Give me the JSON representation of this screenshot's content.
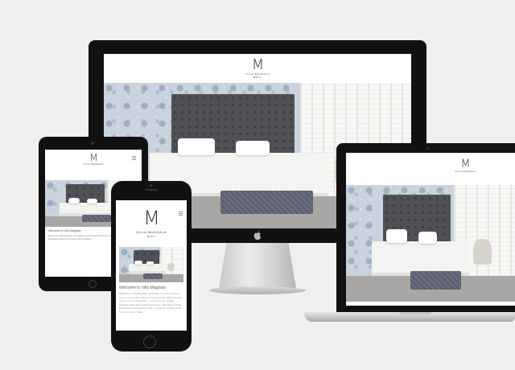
{
  "brand": {
    "logo_mark": "M",
    "name": "VILLA MAGDALA",
    "location": "BATH"
  },
  "phone": {
    "welcome_title": "Welcome to Villa Magdala",
    "body_text": "Welcome to Villa Magdala, a boutique bed and breakfast hotel in central Bath offering the best in affordable boutique city centre accommodation – perfect for city breaks, business stays and romantic getaways. Situated in a quiet residential road opposite a park, yet just ten minutes' stroll from the heart of Bath."
  },
  "tablet": {
    "welcome_title": "Welcome to Villa Magdala",
    "body_text": "Welcome to Villa Magdala, a boutique bed and breakfast hotel in central Bath offering the best in affordable boutique city centre accommodation."
  },
  "icons": {
    "apple": "apple-logo-icon",
    "menu": "hamburger-menu-icon"
  }
}
